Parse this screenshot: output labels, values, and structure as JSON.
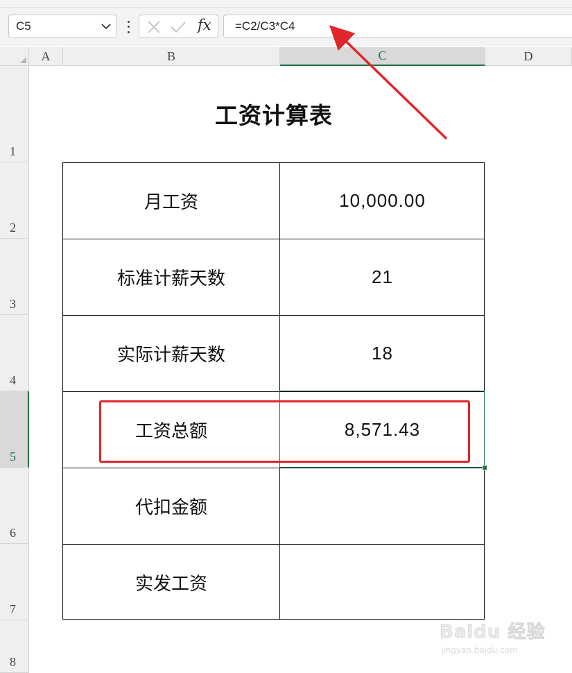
{
  "formula_bar": {
    "name_box": "C5",
    "formula": "=C2/C3*C4",
    "cancel_icon": "close-icon",
    "enter_icon": "check-icon",
    "fx_label": "fx"
  },
  "columns": [
    "A",
    "B",
    "C",
    "D"
  ],
  "rows": [
    "1",
    "2",
    "3",
    "4",
    "5",
    "6",
    "7",
    "8"
  ],
  "sheet": {
    "title": "工资计算表",
    "table": [
      {
        "label": "月工资",
        "value": "10,000.00"
      },
      {
        "label": "标准计薪天数",
        "value": "21"
      },
      {
        "label": "实际计薪天数",
        "value": "18"
      },
      {
        "label": "工资总额",
        "value": "8,571.43"
      },
      {
        "label": "代扣金额",
        "value": ""
      },
      {
        "label": "实发工资",
        "value": ""
      }
    ]
  },
  "selection": {
    "active_cell": "C5",
    "selected_column": "C",
    "selected_row": "5"
  },
  "colors": {
    "accent_green": "#217346",
    "annotation_red": "#e0262b"
  },
  "watermark": {
    "brand": "Baidu 经验",
    "url": "jingyan.baidu.com"
  }
}
